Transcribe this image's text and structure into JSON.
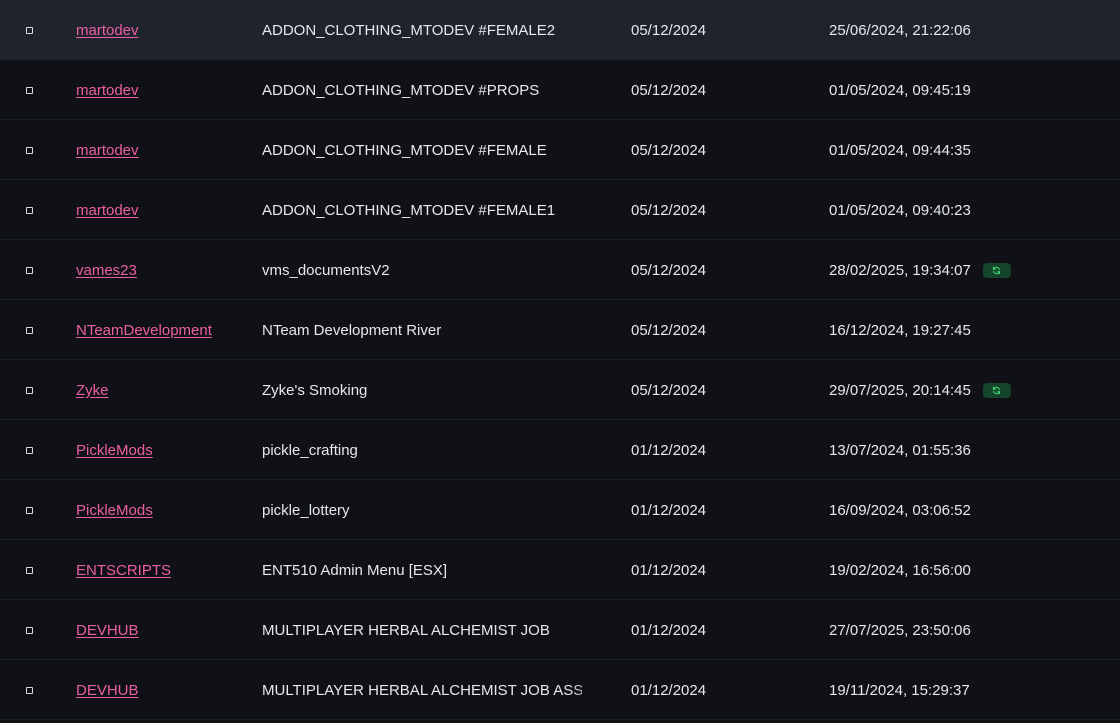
{
  "rows": [
    {
      "author": "martodev",
      "name": "ADDON_CLOTHING_MTODEV #FEMALE2",
      "date": "05/12/2024",
      "updated": "25/06/2024, 21:22:06",
      "has_update": false
    },
    {
      "author": "martodev",
      "name": "ADDON_CLOTHING_MTODEV #PROPS",
      "date": "05/12/2024",
      "updated": "01/05/2024, 09:45:19",
      "has_update": false
    },
    {
      "author": "martodev",
      "name": "ADDON_CLOTHING_MTODEV #FEMALE",
      "date": "05/12/2024",
      "updated": "01/05/2024, 09:44:35",
      "has_update": false
    },
    {
      "author": "martodev",
      "name": "ADDON_CLOTHING_MTODEV #FEMALE1",
      "date": "05/12/2024",
      "updated": "01/05/2024, 09:40:23",
      "has_update": false
    },
    {
      "author": "vames23",
      "name": "vms_documentsV2",
      "date": "05/12/2024",
      "updated": "28/02/2025, 19:34:07",
      "has_update": true
    },
    {
      "author": "NTeamDevelopment",
      "name": "NTeam Development River",
      "date": "05/12/2024",
      "updated": "16/12/2024, 19:27:45",
      "has_update": false
    },
    {
      "author": "Zyke",
      "name": "Zyke's Smoking",
      "date": "05/12/2024",
      "updated": "29/07/2025, 20:14:45",
      "has_update": true
    },
    {
      "author": "PickleMods",
      "name": "pickle_crafting",
      "date": "01/12/2024",
      "updated": "13/07/2024, 01:55:36",
      "has_update": false
    },
    {
      "author": "PickleMods",
      "name": "pickle_lottery",
      "date": "01/12/2024",
      "updated": "16/09/2024, 03:06:52",
      "has_update": false
    },
    {
      "author": "ENTSCRIPTS",
      "name": "ENT510 Admin Menu [ESX]",
      "date": "01/12/2024",
      "updated": "19/02/2024, 16:56:00",
      "has_update": false
    },
    {
      "author": "DEVHUB",
      "name": "MULTIPLAYER HERBAL ALCHEMIST JOB",
      "date": "01/12/2024",
      "updated": "27/07/2025, 23:50:06",
      "has_update": false
    },
    {
      "author": "DEVHUB",
      "name": "MULTIPLAYER HERBAL ALCHEMIST JOB ASSETS",
      "date": "01/12/2024",
      "updated": "19/11/2024, 15:29:37",
      "has_update": false
    }
  ],
  "update_badge_icon": "refresh-icon",
  "colors": {
    "accent_link": "#ec5fa4",
    "update_badge_bg": "#14442a",
    "update_badge_icon": "#3ecf6e",
    "row_highlight": "#1f232c"
  }
}
